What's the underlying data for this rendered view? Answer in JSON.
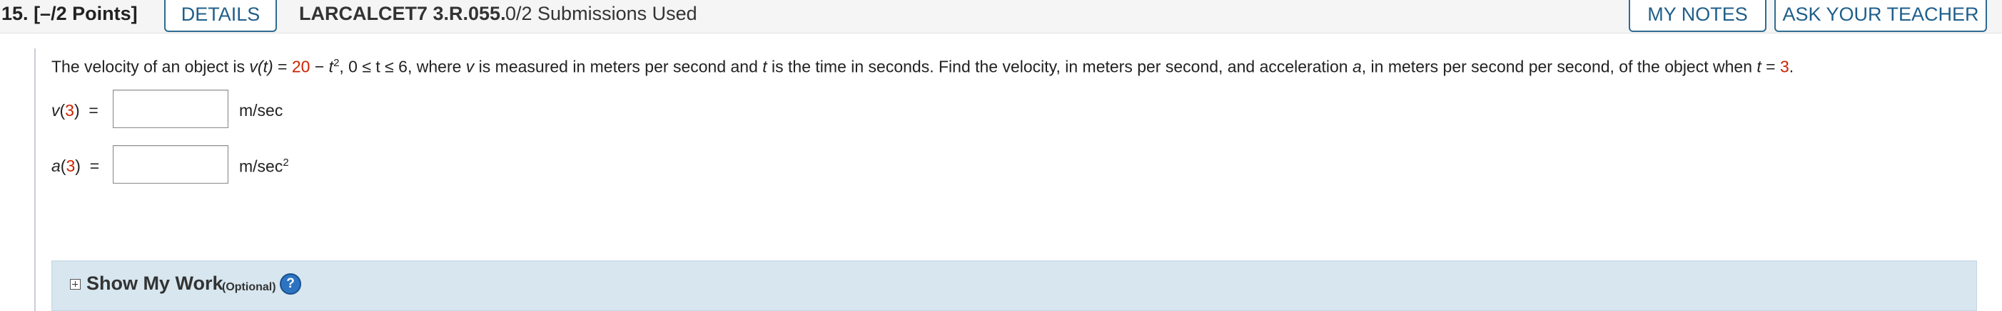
{
  "header": {
    "question_number": "15.",
    "points": "[–/2 Points]",
    "details_label": "DETAILS",
    "problem_code": "LARCALCET7 3.R.055.",
    "submissions": "0/2 Submissions Used",
    "my_notes_label": "MY NOTES",
    "ask_teacher_label": "ASK YOUR TEACHER"
  },
  "question": {
    "intro": "The velocity of an object is ",
    "v_func": "v(t)",
    "eq": " = ",
    "coef": "20",
    "minus": " − ",
    "t": "t",
    "exp": "2",
    "domain": ", 0 ≤ t ≤ 6, where ",
    "v": "v",
    "mid1": " is measured in meters per second and ",
    "t2": "t",
    "mid2": " is the time in seconds. Find the velocity, in meters per second, and acceleration ",
    "a": "a",
    "mid3": ", in meters per second per second, of the object when ",
    "t3": "t",
    "eq2": " = ",
    "t_value": "3",
    "end": "."
  },
  "answers": [
    {
      "func": "v",
      "arg": "3",
      "equals": "=",
      "value": "",
      "unit": "m/sec",
      "unit_exp": ""
    },
    {
      "func": "a",
      "arg": "3",
      "equals": "=",
      "value": "",
      "unit": "m/sec",
      "unit_exp": "2"
    }
  ],
  "work": {
    "title": "Show My Work",
    "optional": "(Optional)",
    "help": "?"
  },
  "colors": {
    "accent": "#1f5f8b",
    "highlight": "#cc2200",
    "work_bg": "#d7e6ef"
  }
}
